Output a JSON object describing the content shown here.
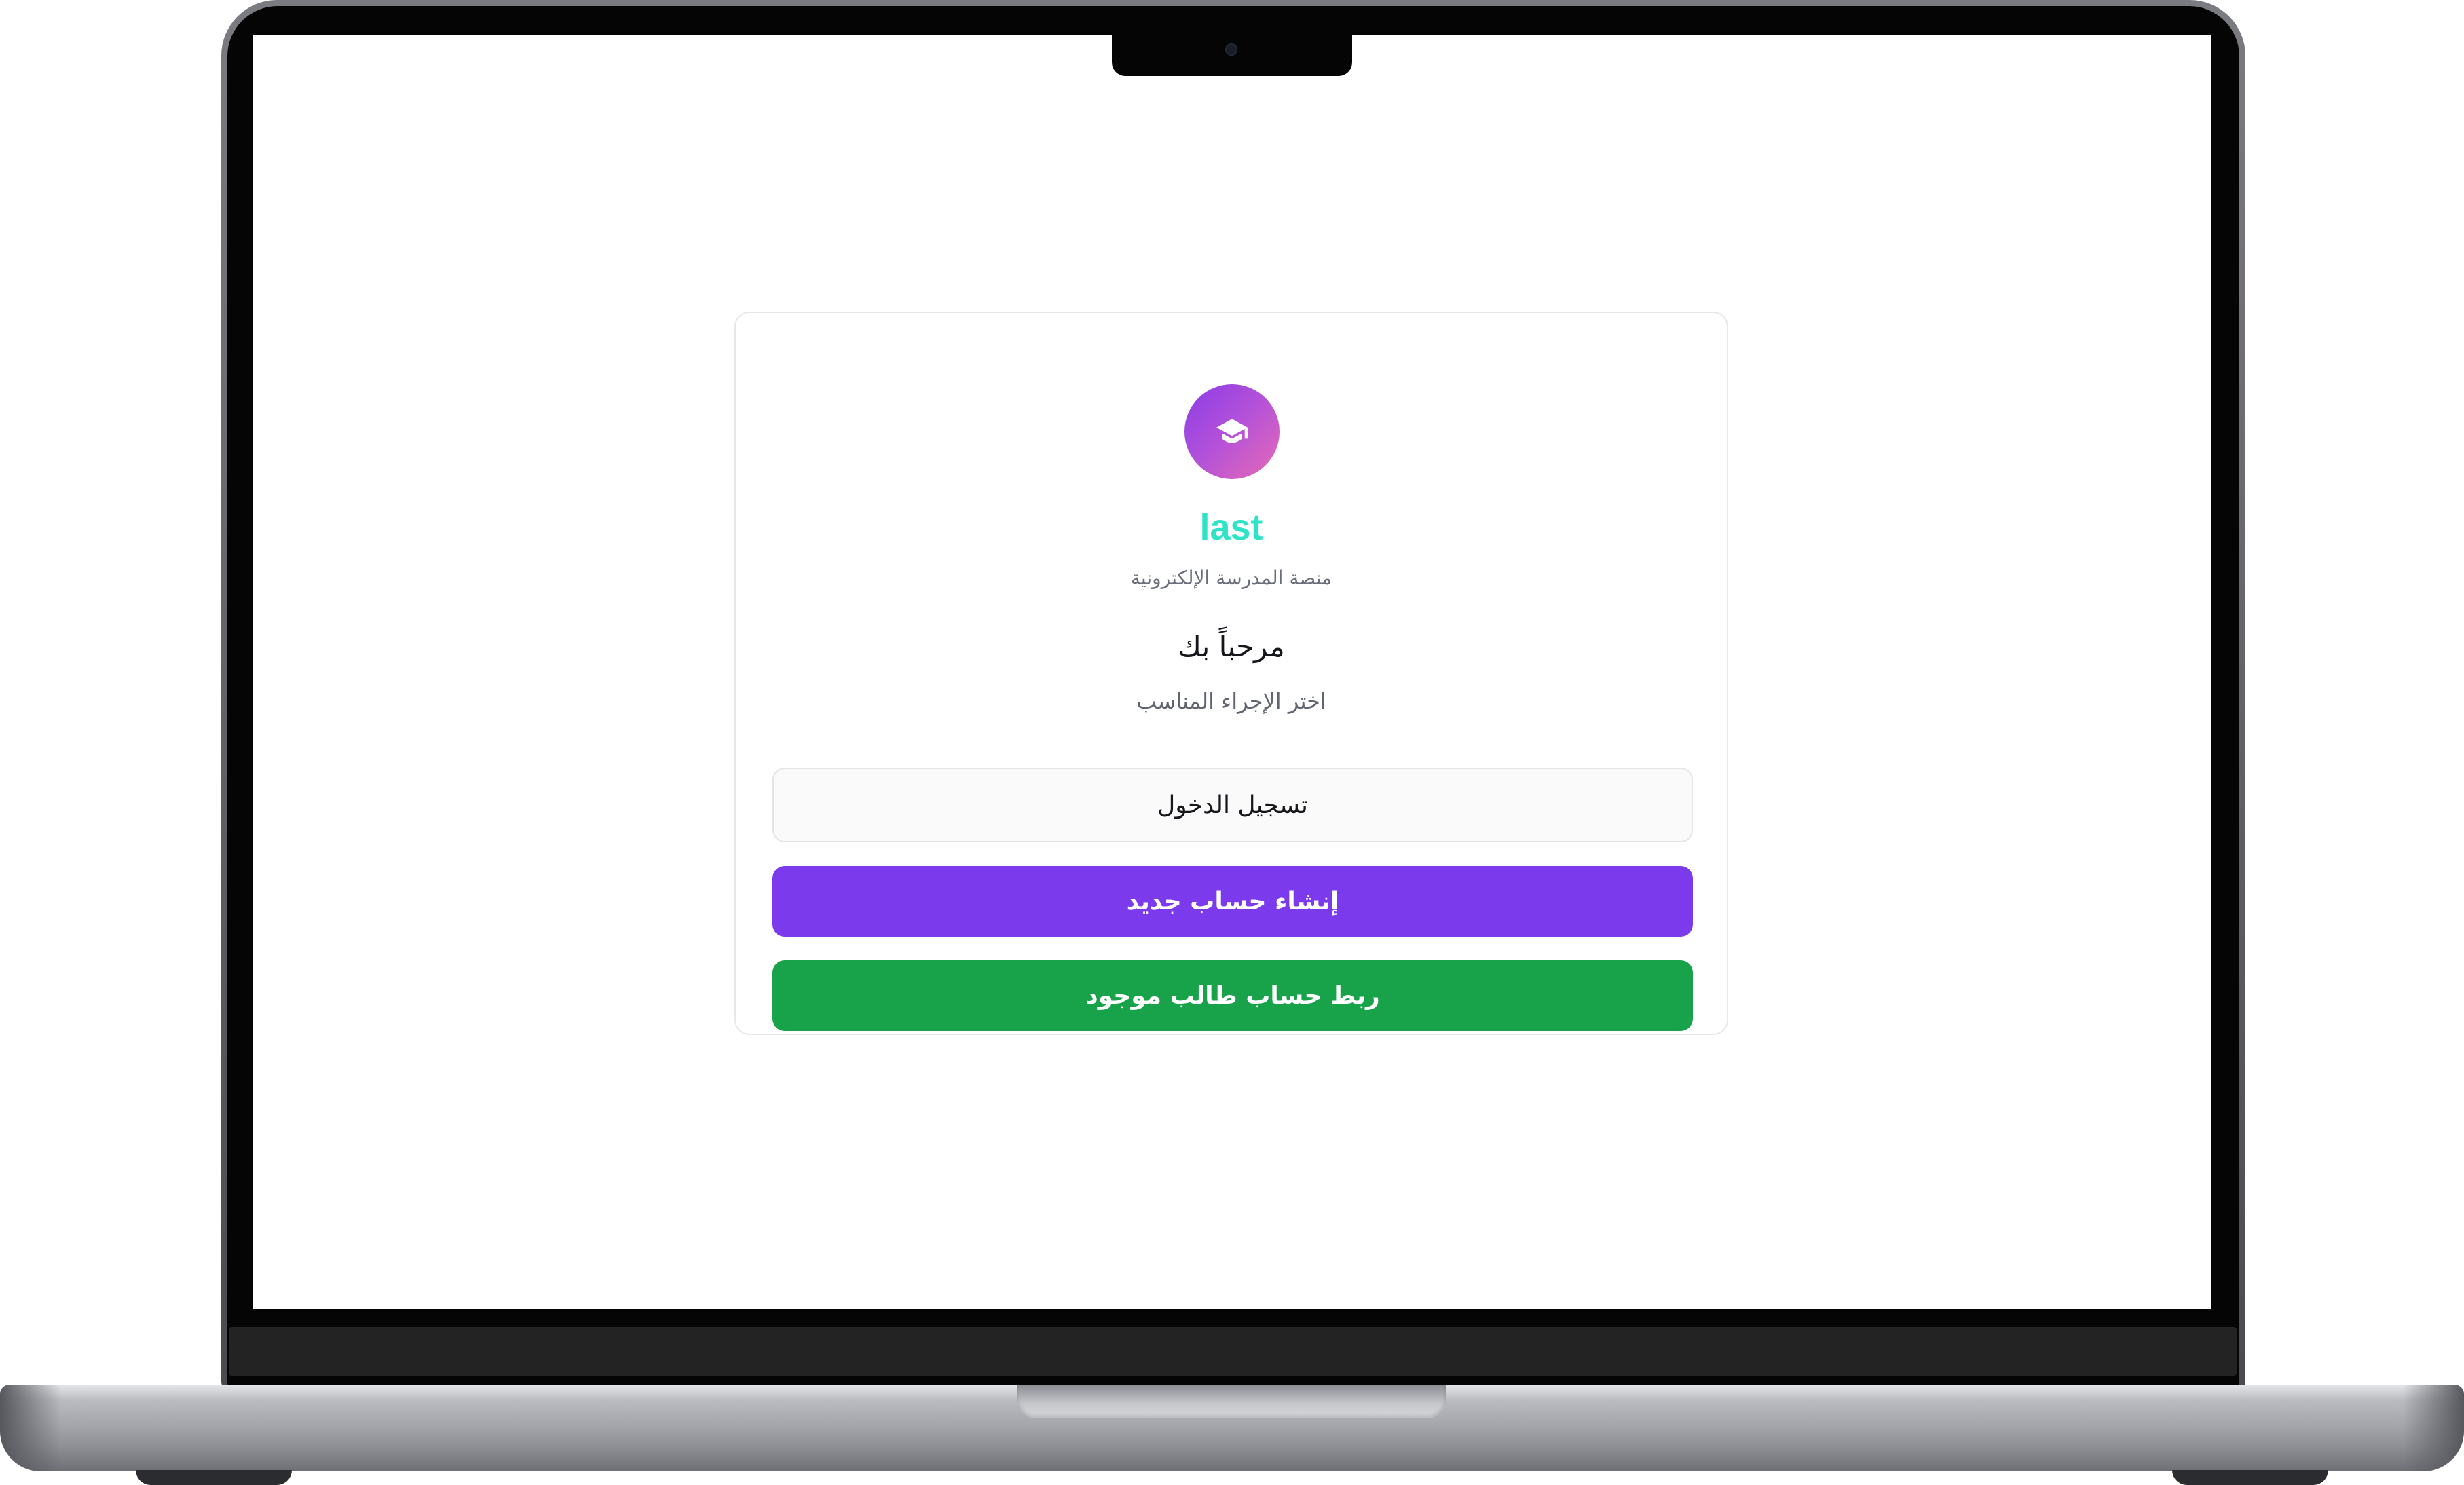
{
  "app": {
    "brand_name": "last",
    "tagline": "منصة المدرسة الإلكترونية",
    "logo_icon": "graduation-cap-icon"
  },
  "welcome": {
    "title": "مرحباً بك",
    "prompt": "اختر الإجراء المناسب"
  },
  "actions": {
    "login_label": "تسجيل الدخول",
    "register_label": "إنشاء حساب جديد",
    "link_student_label": "ربط حساب طالب موجود"
  },
  "colors": {
    "brand_text": "#2fe3c9",
    "register_button": "#7c3aed",
    "link_button": "#18a34a",
    "logo_gradient_start": "#8b3ce6",
    "logo_gradient_end": "#e76bb4"
  }
}
